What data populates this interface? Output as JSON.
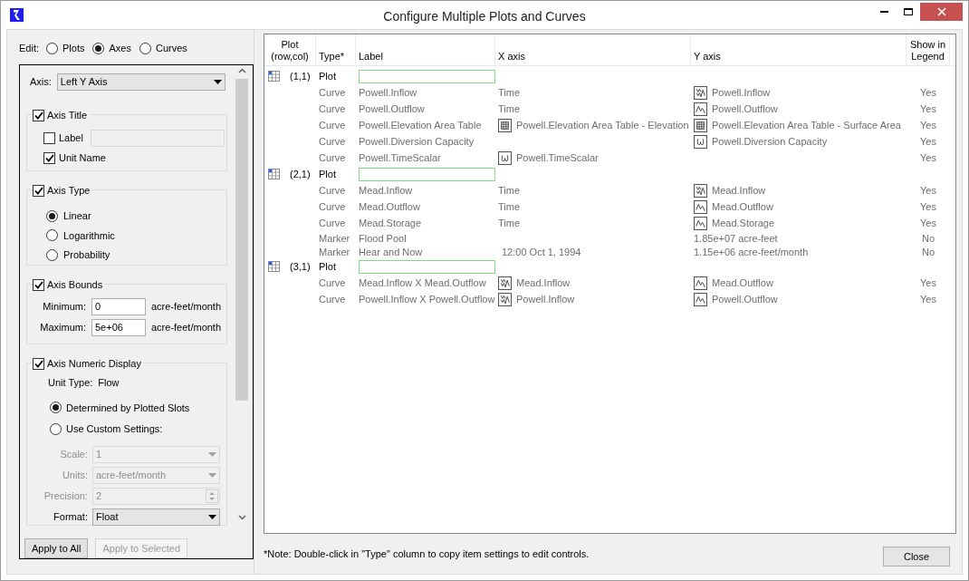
{
  "window": {
    "title": "Configure Multiple Plots and Curves"
  },
  "edit": {
    "label": "Edit:",
    "options": [
      {
        "label": "Plots",
        "selected": false
      },
      {
        "label": "Axes",
        "selected": true
      },
      {
        "label": "Curves",
        "selected": false
      }
    ]
  },
  "axis": {
    "label": "Axis:",
    "value": "Left Y Axis"
  },
  "axis_title": {
    "title": "Axis Title",
    "checked": true,
    "label_option": {
      "label": "Label",
      "checked": false
    },
    "unit_name": {
      "label": "Unit Name",
      "checked": true
    }
  },
  "axis_type": {
    "title": "Axis Type",
    "checked": true,
    "options": [
      {
        "label": "Linear",
        "selected": true
      },
      {
        "label": "Logarithmic",
        "selected": false
      },
      {
        "label": "Probability",
        "selected": false
      }
    ]
  },
  "axis_bounds": {
    "title": "Axis Bounds",
    "checked": true,
    "fields": [
      {
        "label": "Minimum:",
        "value": "0",
        "unit": "acre-feet/month"
      },
      {
        "label": "Maximum:",
        "value": "5e+06",
        "unit": "acre-feet/month"
      }
    ]
  },
  "numeric_display": {
    "title": "Axis Numeric Display",
    "checked": true,
    "unit_type_label": "Unit Type:",
    "unit_type": "Flow",
    "options": [
      {
        "label": "Determined by Plotted Slots",
        "selected": true
      },
      {
        "label": "Use Custom Settings:",
        "selected": false
      }
    ],
    "settings": [
      {
        "kind": "combo",
        "label": "Scale:",
        "value": "1",
        "disabled": true
      },
      {
        "kind": "combo",
        "label": "Units:",
        "value": "acre-feet/month",
        "disabled": true
      },
      {
        "kind": "spin",
        "label": "Precision:",
        "value": "2",
        "disabled": true
      },
      {
        "kind": "combo",
        "label": "Format:",
        "value": "Float",
        "disabled": false
      }
    ]
  },
  "buttons": [
    {
      "label": "Apply to All",
      "disabled": false
    },
    {
      "label": "Apply to Selected",
      "disabled": true
    }
  ],
  "table": {
    "columns": [
      "Plot (row,col)",
      "Type*",
      "Label",
      "X axis",
      "Y axis",
      "Show in Legend"
    ],
    "rows": [
      {
        "kind": "plot",
        "position": "(1,1)",
        "type": "Plot"
      },
      {
        "kind": "curve",
        "type": "Curve",
        "label": "Powell.Inflow",
        "x_axis": {
          "text": "Time"
        },
        "y_axis": {
          "kind": "series2",
          "text": "Powell.Inflow"
        },
        "legend": "Yes"
      },
      {
        "kind": "curve",
        "type": "Curve",
        "label": "Powell.Outflow",
        "x_axis": {
          "text": "Time"
        },
        "y_axis": {
          "kind": "series",
          "text": "Powell.Outflow"
        },
        "legend": "Yes"
      },
      {
        "kind": "curve",
        "type": "Curve",
        "label": "Powell.Elevation Area Table",
        "x_axis": {
          "kind": "table",
          "text": "Powell.Elevation Area Table - Elevation"
        },
        "y_axis": {
          "kind": "table",
          "text": "Powell.Elevation Area Table - Surface Area"
        },
        "legend": "Yes"
      },
      {
        "kind": "curve",
        "type": "Curve",
        "label": "Powell.Diversion Capacity",
        "y_axis": {
          "kind": "scalar",
          "text": "Powell.Diversion Capacity"
        },
        "legend": "Yes"
      },
      {
        "kind": "curve",
        "type": "Curve",
        "label": "Powell.TimeScalar",
        "x_axis": {
          "kind": "scalar",
          "text": "Powell.TimeScalar"
        },
        "legend": "Yes"
      },
      {
        "kind": "plot",
        "position": "(2,1)",
        "type": "Plot"
      },
      {
        "kind": "curve",
        "type": "Curve",
        "label": "Mead.Inflow",
        "x_axis": {
          "text": "Time"
        },
        "y_axis": {
          "kind": "series2",
          "text": "Mead.Inflow"
        },
        "legend": "Yes"
      },
      {
        "kind": "curve",
        "type": "Curve",
        "label": "Mead.Outflow",
        "x_axis": {
          "text": "Time"
        },
        "y_axis": {
          "kind": "series",
          "text": "Mead.Outflow"
        },
        "legend": "Yes"
      },
      {
        "kind": "curve",
        "type": "Curve",
        "label": "Mead.Storage",
        "x_axis": {
          "text": "Time"
        },
        "y_axis": {
          "kind": "series",
          "text": "Mead.Storage"
        },
        "legend": "Yes"
      },
      {
        "kind": "marker",
        "type": "Marker",
        "label": "Flood Pool",
        "y_axis": {
          "text": "1.85e+07 acre-feet"
        },
        "legend": "No"
      },
      {
        "kind": "marker",
        "type": "Marker",
        "label": "Hear and Now",
        "x_axis": {
          "text": "12:00 Oct 1, 1994"
        },
        "y_axis": {
          "text": "1.15e+06 acre-feet/month"
        },
        "legend": "No"
      },
      {
        "kind": "plot",
        "position": "(3,1)",
        "type": "Plot"
      },
      {
        "kind": "curve",
        "type": "Curve",
        "label": "Mead.Inflow X Mead.Outflow",
        "x_axis": {
          "kind": "series2",
          "text": "Mead.Inflow"
        },
        "y_axis": {
          "kind": "series",
          "text": "Mead.Outflow"
        },
        "legend": "Yes"
      },
      {
        "kind": "curve",
        "type": "Curve",
        "label": "Powell.Inflow X Powell.Outflow",
        "x_axis": {
          "kind": "series2",
          "text": "Powell.Inflow"
        },
        "y_axis": {
          "kind": "series",
          "text": "Powell.Outflow"
        },
        "legend": "Yes"
      }
    ]
  },
  "note": "*Note: Double-click in \"Type\" column to copy item settings to edit controls.",
  "close_button": "Close"
}
